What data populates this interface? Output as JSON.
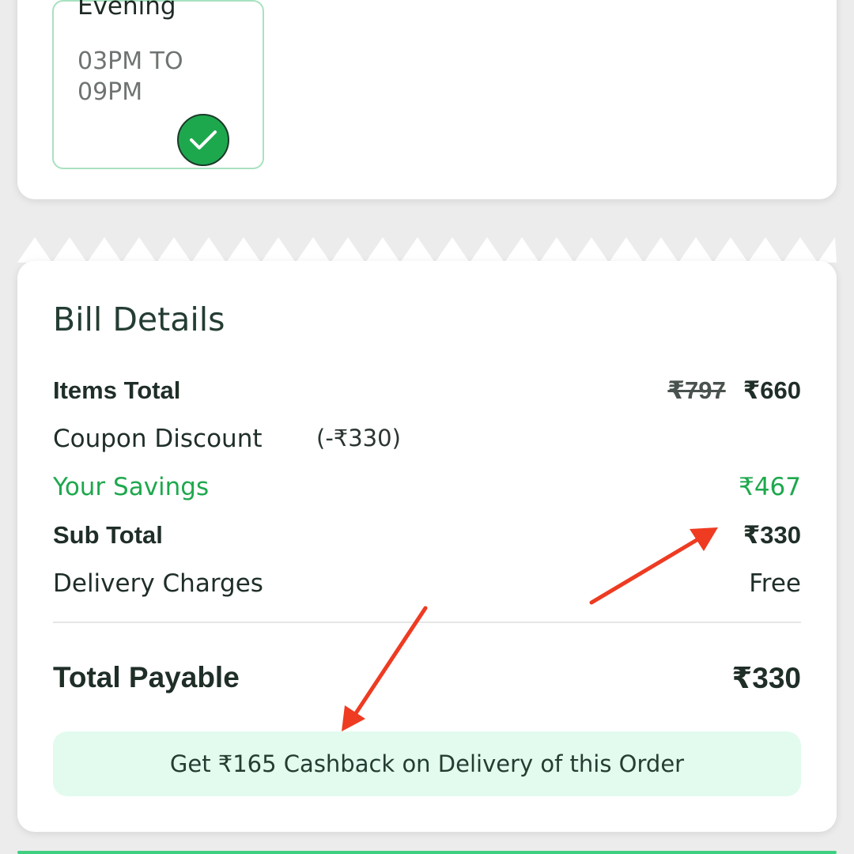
{
  "slot": {
    "name": "Evening",
    "time": "03PM TO 09PM",
    "selected": true
  },
  "bill": {
    "title": "Bill Details",
    "items_total": {
      "label": "Items Total",
      "original": "₹797",
      "value": "₹660"
    },
    "coupon": {
      "label": "Coupon Discount",
      "value": "(-₹330)"
    },
    "savings": {
      "label": "Your Savings",
      "value": "₹467"
    },
    "sub_total": {
      "label": "Sub Total",
      "value": "₹330"
    },
    "delivery": {
      "label": "Delivery Charges",
      "value": "Free"
    },
    "total": {
      "label": "Total Payable",
      "value": "₹330"
    },
    "cashback_text": "Get ₹165 Cashback on Delivery of this Order"
  },
  "colors": {
    "accent_green": "#1ea84d",
    "cashback_bg": "#e2fbee",
    "annotation_arrow": "#ee3b22"
  },
  "icons": {
    "selected": "check-icon",
    "annotation": "arrow-annotation"
  }
}
